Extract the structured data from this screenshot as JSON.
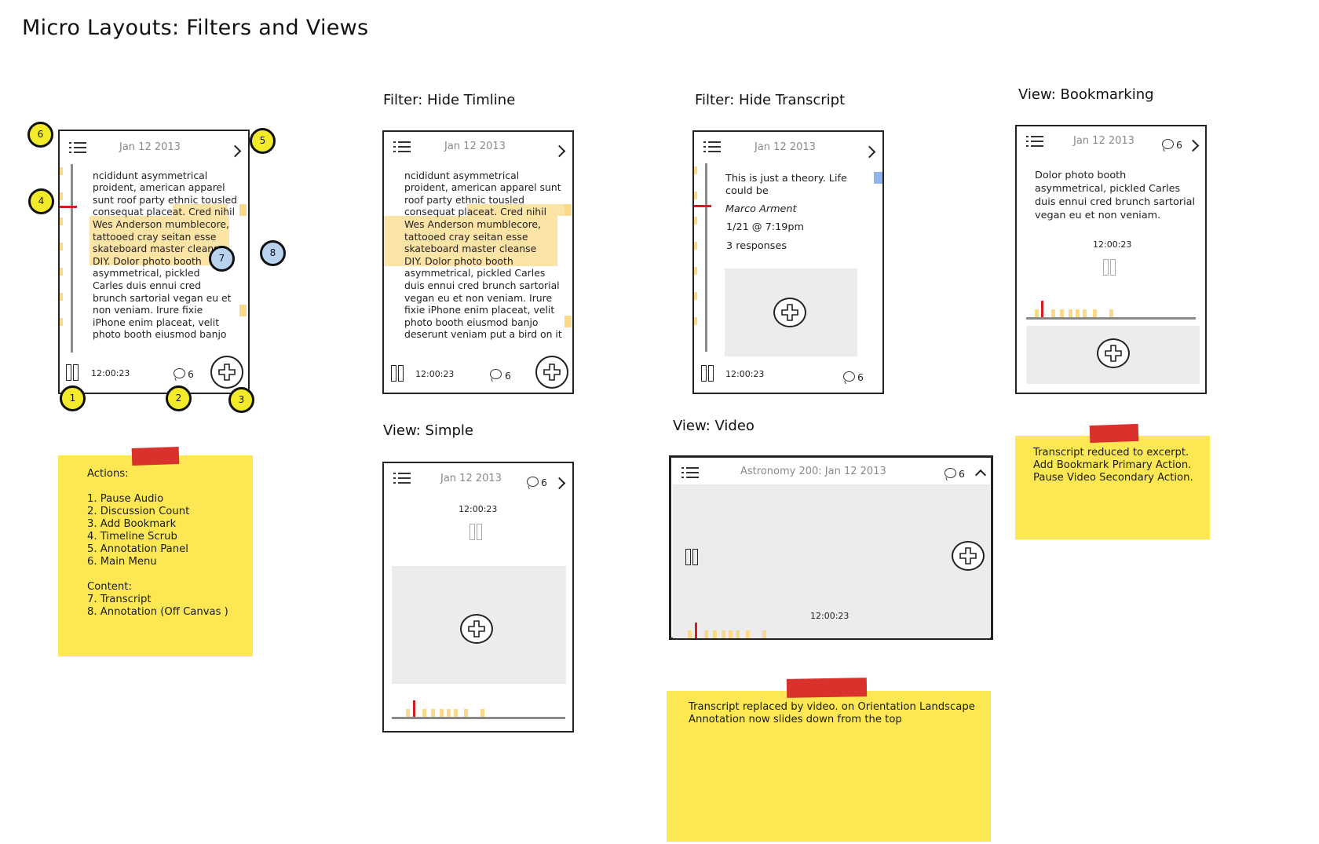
{
  "page_title": "Micro Layouts: Filters and Views",
  "section_titles": {
    "hide_timeline": "Filter: Hide Timline",
    "hide_transcript": "Filter: Hide Transcript",
    "bookmarking": "View: Bookmarking",
    "simple": "View: Simple",
    "video": "View: Video"
  },
  "common": {
    "date": "Jan 12 2013",
    "time": "12:00:23",
    "comment_count": "6",
    "video_title": "Astronomy 200: Jan 12 2013"
  },
  "main_transcript": [
    "ncididunt asymmetrical",
    "proident, american apparel",
    "sunt roof party ethnic tousled",
    "consequat placeat. Cred nihil",
    "Wes Anderson mumblecore,",
    "tattooed cray seitan esse",
    "skateboard master cleanse",
    "DIY. Dolor photo booth",
    "asymmetrical, pickled",
    "Carles duis ennui cred",
    "brunch sartorial vegan eu et",
    "non veniam. Irure fixie",
    "iPhone enim placeat, velit",
    "photo booth eiusmod banjo"
  ],
  "hide_timeline_transcript": [
    "ncididunt asymmetrical",
    "proident, american apparel sunt",
    "roof party ethnic tousled",
    "consequat placeat. Cred nihil",
    "Wes Anderson mumblecore,",
    "tattooed cray seitan esse",
    "skateboard master cleanse",
    "DIY. Dolor photo booth",
    "asymmetrical, pickled Carles",
    "duis ennui cred brunch sartorial",
    "vegan eu et non veniam. Irure",
    "fixie iPhone enim placeat, velit",
    "photo booth eiusmod banjo",
    "deserunt veniam put a bird on it"
  ],
  "annotation": {
    "quote_line1": "This is just a theory. Life",
    "quote_line2": "could be",
    "author": "Marco Arment",
    "timestamp": "1/21 @ 7:19pm",
    "responses": "3 responses"
  },
  "bookmark_excerpt": [
    "Dolor photo booth",
    "asymmetrical, pickled Carles",
    "duis ennui cred brunch sartorial",
    "vegan eu et non veniam."
  ],
  "markers": {
    "m1": "1",
    "m2": "2",
    "m3": "3",
    "m4": "4",
    "m5": "5",
    "m6": "6",
    "m7": "7",
    "m8": "8"
  },
  "notes": {
    "actions_note": "Actions:\n\n1. Pause Audio\n2. Discussion Count\n3. Add Bookmark\n4. Timeline Scrub\n5. Annotation Panel\n6. Main Menu\n\nContent:\n7. Transcript\n8. Annotation (Off Canvas )",
    "bookmark_note": "Transcript reduced to excerpt.\nAdd Bookmark Primary Action.\nPause Video Secondary Action.",
    "video_note": "Transcript replaced by video. on Orientation Landscape\nAnnotation now slides down from the top"
  },
  "colors": {
    "sticky": "#fde854",
    "tape": "#d9322c",
    "highlight": "#fce3a6",
    "scrub_red": "#d11f1f",
    "annotation_blue": "#b9d3ef"
  }
}
